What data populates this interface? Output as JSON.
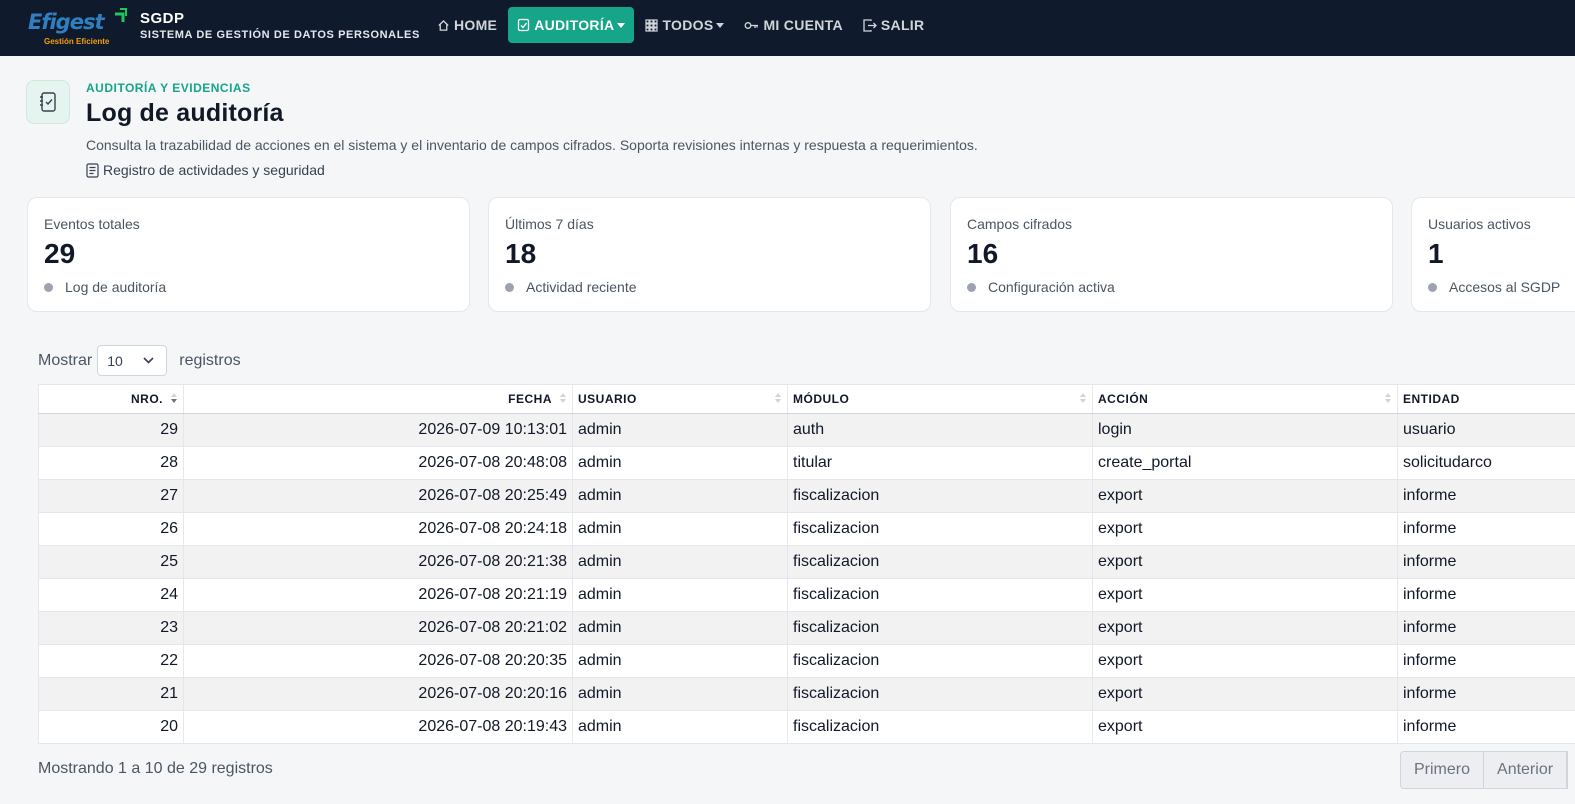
{
  "brand": {
    "logo_text": "Efigest",
    "logo_tagline": "Gestión Eficiente",
    "name": "SGDP",
    "subtitle": "SISTEMA DE GESTIÓN DE DATOS PERSONALES"
  },
  "nav": {
    "home": "HOME",
    "auditoria": "AUDITORÍA",
    "todos": "TODOS",
    "mi_cuenta": "MI CUENTA",
    "salir": "SALIR"
  },
  "header": {
    "eyebrow": "AUDITORÍA Y EVIDENCIAS",
    "title": "Log de auditoría",
    "description": "Consulta la trazabilidad de acciones en el sistema y el inventario de campos cifrados. Soporta revisiones internas y respuesta a requerimientos.",
    "note": "Registro de actividades y seguridad"
  },
  "stats": [
    {
      "label": "Eventos totales",
      "value": "29",
      "foot": "Log de auditoría"
    },
    {
      "label": "Últimos 7 días",
      "value": "18",
      "foot": "Actividad reciente"
    },
    {
      "label": "Campos cifrados",
      "value": "16",
      "foot": "Configuración activa"
    },
    {
      "label": "Usuarios activos",
      "value": "1",
      "foot": "Accesos al SGDP"
    }
  ],
  "length": {
    "prefix": "Mostrar",
    "value": "10",
    "suffix": "registros"
  },
  "table": {
    "columns": [
      "NRO.",
      "FECHA",
      "USUARIO",
      "MÓDULO",
      "ACCIÓN",
      "ENTIDAD"
    ],
    "rows": [
      [
        "29",
        "2026-07-09 10:13:01",
        "admin",
        "auth",
        "login",
        "usuario"
      ],
      [
        "28",
        "2026-07-08 20:48:08",
        "admin",
        "titular",
        "create_portal",
        "solicitudarco"
      ],
      [
        "27",
        "2026-07-08 20:25:49",
        "admin",
        "fiscalizacion",
        "export",
        "informe"
      ],
      [
        "26",
        "2026-07-08 20:24:18",
        "admin",
        "fiscalizacion",
        "export",
        "informe"
      ],
      [
        "25",
        "2026-07-08 20:21:38",
        "admin",
        "fiscalizacion",
        "export",
        "informe"
      ],
      [
        "24",
        "2026-07-08 20:21:19",
        "admin",
        "fiscalizacion",
        "export",
        "informe"
      ],
      [
        "23",
        "2026-07-08 20:21:02",
        "admin",
        "fiscalizacion",
        "export",
        "informe"
      ],
      [
        "22",
        "2026-07-08 20:20:35",
        "admin",
        "fiscalizacion",
        "export",
        "informe"
      ],
      [
        "21",
        "2026-07-08 20:20:16",
        "admin",
        "fiscalizacion",
        "export",
        "informe"
      ],
      [
        "20",
        "2026-07-08 20:19:43",
        "admin",
        "fiscalizacion",
        "export",
        "informe"
      ]
    ]
  },
  "footer": {
    "info": "Mostrando 1 a 10 de 29 registros",
    "first": "Primero",
    "previous": "Anterior"
  }
}
